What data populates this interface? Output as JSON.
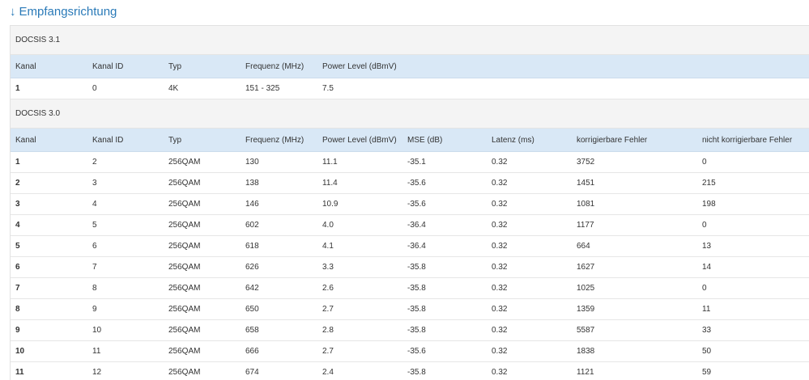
{
  "title": {
    "arrow": "↓",
    "text": "Empfangsrichtung"
  },
  "docsis31": {
    "label": "DOCSIS 3.1",
    "headers": [
      "Kanal",
      "Kanal ID",
      "Typ",
      "Frequenz (MHz)",
      "Power Level (dBmV)"
    ],
    "rows": [
      [
        "1",
        "0",
        "4K",
        "151 - 325",
        "7.5"
      ]
    ]
  },
  "docsis30": {
    "label": "DOCSIS 3.0",
    "headers": [
      "Kanal",
      "Kanal ID",
      "Typ",
      "Frequenz (MHz)",
      "Power Level (dBmV)",
      "MSE (dB)",
      "Latenz (ms)",
      "korrigierbare Fehler",
      "nicht korrigierbare Fehler"
    ],
    "rows": [
      [
        "1",
        "2",
        "256QAM",
        "130",
        "11.1",
        "-35.1",
        "0.32",
        "3752",
        "0"
      ],
      [
        "2",
        "3",
        "256QAM",
        "138",
        "11.4",
        "-35.6",
        "0.32",
        "1451",
        "215"
      ],
      [
        "3",
        "4",
        "256QAM",
        "146",
        "10.9",
        "-35.6",
        "0.32",
        "1081",
        "198"
      ],
      [
        "4",
        "5",
        "256QAM",
        "602",
        "4.0",
        "-36.4",
        "0.32",
        "1177",
        "0"
      ],
      [
        "5",
        "6",
        "256QAM",
        "618",
        "4.1",
        "-36.4",
        "0.32",
        "664",
        "13"
      ],
      [
        "6",
        "7",
        "256QAM",
        "626",
        "3.3",
        "-35.8",
        "0.32",
        "1627",
        "14"
      ],
      [
        "7",
        "8",
        "256QAM",
        "642",
        "2.6",
        "-35.8",
        "0.32",
        "1025",
        "0"
      ],
      [
        "8",
        "9",
        "256QAM",
        "650",
        "2.7",
        "-35.8",
        "0.32",
        "1359",
        "11"
      ],
      [
        "9",
        "10",
        "256QAM",
        "658",
        "2.8",
        "-35.8",
        "0.32",
        "5587",
        "33"
      ],
      [
        "10",
        "11",
        "256QAM",
        "666",
        "2.7",
        "-35.6",
        "0.32",
        "1838",
        "50"
      ],
      [
        "11",
        "12",
        "256QAM",
        "674",
        "2.4",
        "-35.8",
        "0.32",
        "1121",
        "59"
      ]
    ]
  }
}
